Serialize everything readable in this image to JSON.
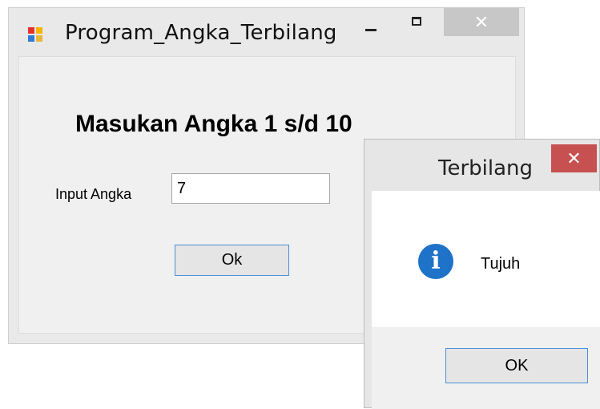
{
  "main_window": {
    "title": "Program_Angka_Terbilang",
    "controls": {
      "minimize": "–",
      "maximize": "□",
      "close": "✕"
    },
    "heading": "Masukan Angka 1 s/d 10",
    "input_label": "Input Angka",
    "input_value": "7",
    "ok_button": "Ok"
  },
  "message_box": {
    "title": "Terbilang",
    "close": "✕",
    "icon": "info-icon",
    "message": "Tujuh",
    "ok_button": "OK"
  }
}
